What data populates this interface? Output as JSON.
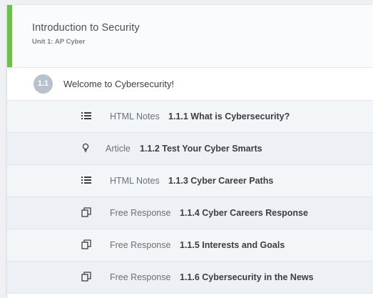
{
  "module": {
    "title": "Introduction to Security",
    "subtitle": "Unit 1: AP Cyber",
    "accent_color": "#6cc04a"
  },
  "lesson": {
    "number": "1.1",
    "title": "Welcome to Cybersecurity!"
  },
  "items": [
    {
      "type": "HTML Notes",
      "title": "1.1.1 What is Cybersecurity?",
      "icon": "list-icon"
    },
    {
      "type": "Article",
      "title": "1.1.2 Test Your Cyber Smarts",
      "icon": "lightbulb-icon"
    },
    {
      "type": "HTML Notes",
      "title": "1.1.3 Cyber Career Paths",
      "icon": "list-icon"
    },
    {
      "type": "Free Response",
      "title": "1.1.4 Cyber Careers Response",
      "icon": "copy-icon"
    },
    {
      "type": "Free Response",
      "title": "1.1.5 Interests and Goals",
      "icon": "copy-icon"
    },
    {
      "type": "Free Response",
      "title": "1.1.6 Cybersecurity in the News",
      "icon": "copy-icon"
    }
  ]
}
